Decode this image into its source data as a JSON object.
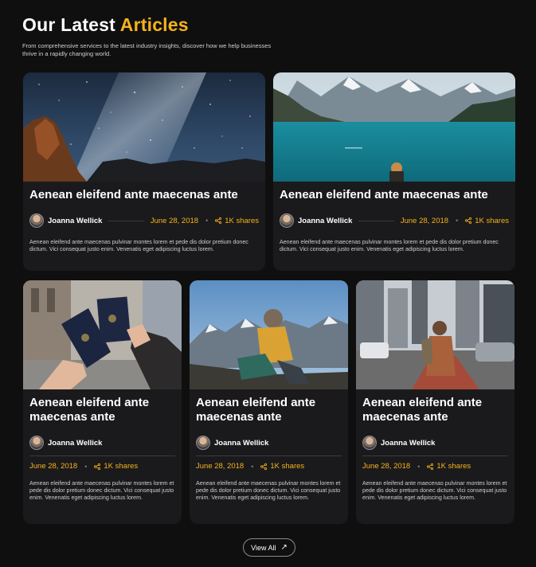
{
  "header": {
    "title_main": "Our Latest",
    "title_accent": "Articles",
    "subtitle": "From comprehensive services to the latest industry insights, discover how we help businesses thrive in a rapidly changing world."
  },
  "colors": {
    "accent": "#f6b21b",
    "background": "#0f0f10",
    "card": "#1a1a1c"
  },
  "articles": [
    {
      "image": "night-sky-rocks",
      "title": "Aenean eleifend ante maecenas ante",
      "author": "Joanna Wellick",
      "date": "June 28, 2018",
      "shares": "1K shares",
      "excerpt": "Aenean eleifend ante maecenas pulvinar montes lorem et pede dis dolor pretium donec dictum. Vici consequat justo enim. Venenatis eget adipiscing luctus lorem."
    },
    {
      "image": "mountain-lake",
      "title": "Aenean eleifend ante maecenas ante",
      "author": "Joanna Wellick",
      "date": "June 28, 2018",
      "shares": "1K shares",
      "excerpt": "Aenean eleifend ante maecenas pulvinar montes lorem et pede dis dolor pretium donec dictum. Vici consequat justo enim. Venenatis eget adipiscing luctus lorem."
    },
    {
      "image": "passports",
      "title": "Aenean eleifend ante maecenas ante",
      "author": "Joanna Wellick",
      "date": "June 28, 2018",
      "shares": "1K shares",
      "excerpt": "Aenean eleifend ante maecenas pulvinar montes lorem et pede dis dolor pretium donec dictum. Vici consequat justo enim. Venenatis eget adipiscing luctus lorem."
    },
    {
      "image": "hiker-mountains",
      "title": "Aenean eleifend ante maecenas ante",
      "author": "Joanna Wellick",
      "date": "June 28, 2018",
      "shares": "1K shares",
      "excerpt": "Aenean eleifend ante maecenas pulvinar montes lorem et pede dis dolor pretium donec dictum. Vici consequat justo enim. Venenatis eget adipiscing luctus lorem."
    },
    {
      "image": "city-street",
      "title": "Aenean eleifend ante maecenas ante",
      "author": "Joanna Wellick",
      "date": "June 28, 2018",
      "shares": "1K shares",
      "excerpt": "Aenean eleifend ante maecenas pulvinar montes lorem et pede dis dolor pretium donec dictum. Vici consequat justo enim. Venenatis eget adipiscing luctus lorem."
    }
  ],
  "footer": {
    "view_all_label": "View All",
    "view_all_icon": "arrow-up-right-icon"
  }
}
